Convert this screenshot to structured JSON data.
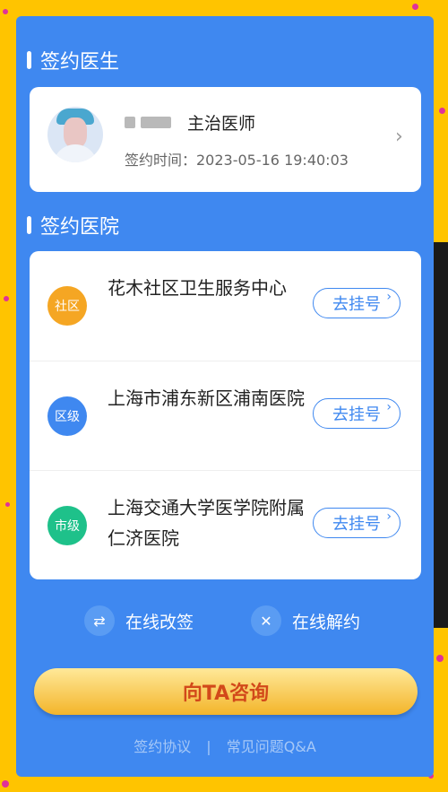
{
  "doctor_section": {
    "title": "签约医生",
    "role": "主治医师",
    "sign_time": "签约时间：2023-05-16 19:40:03"
  },
  "hospital_section": {
    "title": "签约医院",
    "hospitals": [
      {
        "badge": "社区",
        "badge_color": "#f5a623",
        "name": "花木社区卫生服务中心",
        "button": "去挂号"
      },
      {
        "badge": "区级",
        "badge_color": "#3f88f0",
        "name": "上海市浦东新区浦南医院",
        "button": "去挂号"
      },
      {
        "badge": "市级",
        "badge_color": "#1ec18a",
        "name": "上海交通大学医学院附属仁济医院",
        "button": "去挂号"
      }
    ]
  },
  "actions": {
    "change_sign": "在线改签",
    "cancel_sign": "在线解约"
  },
  "consult_button": "向TA咨询",
  "footer": {
    "agreement": "签约协议",
    "separator": "|",
    "faq": "常见问题Q&A"
  },
  "colors": {
    "background": "#ffc400",
    "panel": "#3f88f0",
    "dots": "#e0319a"
  }
}
